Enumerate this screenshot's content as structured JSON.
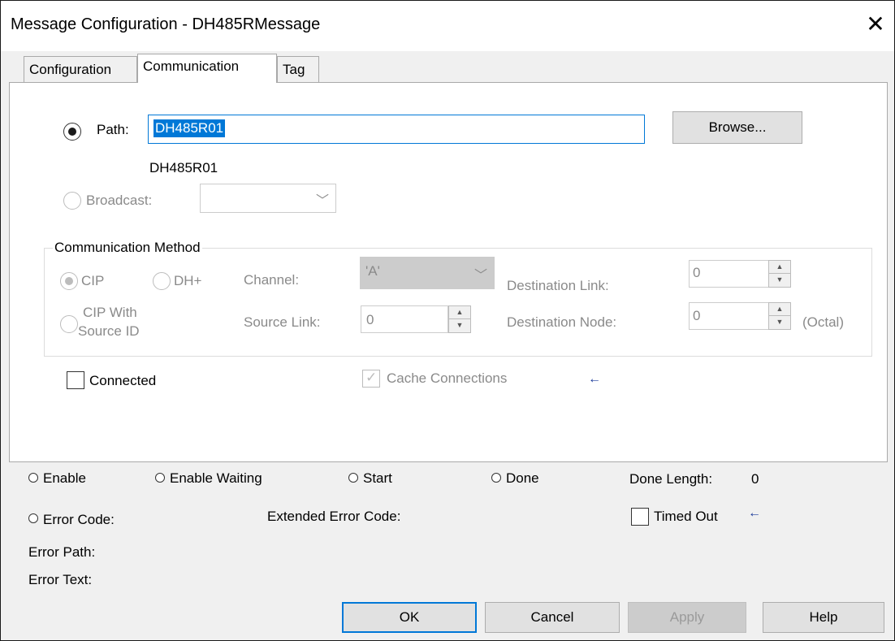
{
  "window": {
    "title": "Message Configuration - DH485RMessage",
    "close_glyph": "✕"
  },
  "tabs": [
    {
      "label": "Configuration"
    },
    {
      "label": "Communication"
    },
    {
      "label": "Tag"
    }
  ],
  "path": {
    "label": "Path:",
    "value": "DH485R01",
    "resolved": "DH485R01",
    "browse_label": "Browse..."
  },
  "broadcast": {
    "label": "Broadcast:",
    "value": ""
  },
  "comm_method": {
    "group_label": "Communication Method",
    "cip_label": "CIP",
    "dhplus_label": "DH+",
    "cip_source_line1": "CIP With",
    "cip_source_line2": "Source ID",
    "channel_label": "Channel:",
    "channel_value": "'A'",
    "dest_link_label": "Destination Link:",
    "dest_link_value": "0",
    "source_link_label": "Source Link:",
    "source_link_value": "0",
    "dest_node_label": "Destination Node:",
    "dest_node_value": "0",
    "octal_label": "(Octal)"
  },
  "options": {
    "connected_label": "Connected",
    "cache_label": "Cache Connections"
  },
  "status": {
    "enable_label": "Enable",
    "enable_waiting_label": "Enable Waiting",
    "start_label": "Start",
    "done_label": "Done",
    "done_length_label": "Done Length:",
    "done_length_value": "0",
    "error_code_label": "Error Code:",
    "extended_error_label": "Extended Error Code:",
    "timed_out_label": "Timed Out",
    "error_path_label": "Error Path:",
    "error_text_label": "Error Text:"
  },
  "buttons": {
    "ok": "OK",
    "cancel": "Cancel",
    "apply": "Apply",
    "help": "Help"
  },
  "colors": {
    "selection": "#0078d7",
    "arrow": "#1a3a9a",
    "disabled_text": "#8a8a8a"
  }
}
